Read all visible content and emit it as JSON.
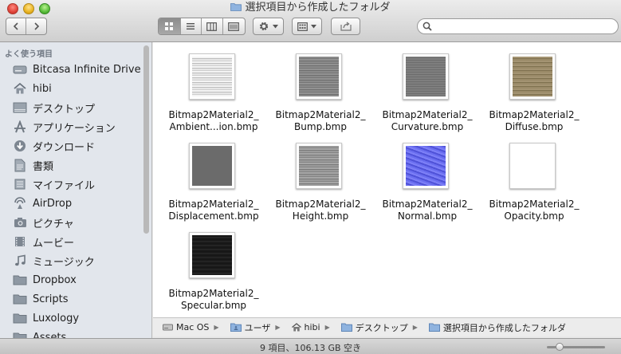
{
  "window": {
    "title": "選択項目から作成したフォルダ"
  },
  "toolbar": {
    "back_icon": "chevron-left-icon",
    "forward_icon": "chevron-right-icon",
    "view_modes": [
      "icon-view",
      "list-view",
      "column-view",
      "coverflow-view"
    ],
    "active_view": "icon-view",
    "action_icon": "gear-icon",
    "arrange_icon": "arrange-grid-icon",
    "share_icon": "share-icon",
    "search_placeholder": ""
  },
  "sidebar": {
    "heading": "よく使う項目",
    "items": [
      {
        "label": "Bitcasa Infinite Drive",
        "icon": "drive-icon"
      },
      {
        "label": "hibi",
        "icon": "home-icon"
      },
      {
        "label": "デスクトップ",
        "icon": "desktop-icon"
      },
      {
        "label": "アプリケーション",
        "icon": "applications-icon"
      },
      {
        "label": "ダウンロード",
        "icon": "downloads-icon"
      },
      {
        "label": "書類",
        "icon": "documents-icon"
      },
      {
        "label": "マイファイル",
        "icon": "all-my-files-icon"
      },
      {
        "label": "AirDrop",
        "icon": "airdrop-icon"
      },
      {
        "label": "ピクチャ",
        "icon": "camera-icon"
      },
      {
        "label": "ムービー",
        "icon": "movie-icon"
      },
      {
        "label": "ミュージック",
        "icon": "music-icon"
      },
      {
        "label": "Dropbox",
        "icon": "folder-icon"
      },
      {
        "label": "Scripts",
        "icon": "folder-icon"
      },
      {
        "label": "Luxology",
        "icon": "folder-icon"
      },
      {
        "label": "Assets",
        "icon": "folder-icon"
      }
    ]
  },
  "files": [
    {
      "line1": "Bitmap2Material2_",
      "line2": "Ambient...ion.bmp",
      "texture": "ambient"
    },
    {
      "line1": "Bitmap2Material2_",
      "line2": "Bump.bmp",
      "texture": "bump"
    },
    {
      "line1": "Bitmap2Material2_",
      "line2": "Curvature.bmp",
      "texture": "curvature"
    },
    {
      "line1": "Bitmap2Material2_",
      "line2": "Diffuse.bmp",
      "texture": "diffuse"
    },
    {
      "line1": "Bitmap2Material2_",
      "line2": "Displacement.bmp",
      "texture": "displacement"
    },
    {
      "line1": "Bitmap2Material2_",
      "line2": "Height.bmp",
      "texture": "height"
    },
    {
      "line1": "Bitmap2Material2_",
      "line2": "Normal.bmp",
      "texture": "normal"
    },
    {
      "line1": "Bitmap2Material2_",
      "line2": "Opacity.bmp",
      "texture": "opacity"
    },
    {
      "line1": "Bitmap2Material2_",
      "line2": "Specular.bmp",
      "texture": "specular"
    }
  ],
  "pathbar": {
    "crumbs": [
      {
        "label": "Mac OS",
        "icon": "hard-drive-icon"
      },
      {
        "label": "ユーザ",
        "icon": "users-folder-icon"
      },
      {
        "label": "hibi",
        "icon": "home-icon"
      },
      {
        "label": "デスクトップ",
        "icon": "folder-icon"
      },
      {
        "label": "選択項目から作成したフォルダ",
        "icon": "folder-icon"
      }
    ]
  },
  "status": {
    "text": "9 項目、106.13 GB 空き",
    "icon_size_level": 0.2
  },
  "colors": {
    "sidebar_bg": "#e2e6ec",
    "content_bg": "#ffffff",
    "folder_blue": "#7fa6d6"
  }
}
